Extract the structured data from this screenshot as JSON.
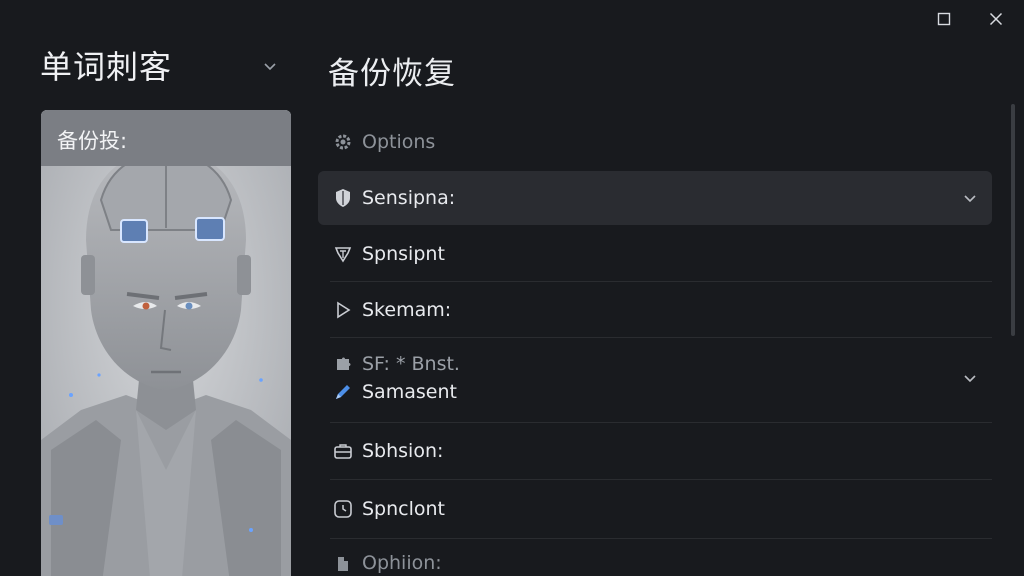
{
  "app": {
    "title": "单词刺客"
  },
  "card": {
    "header": "备份投:"
  },
  "main": {
    "title": "备份恢复",
    "items": [
      {
        "label": "Options",
        "icon": "gear-icon"
      },
      {
        "label": "Sensipna:",
        "icon": "shield-icon"
      },
      {
        "label": "Spnsipnt",
        "icon": "emblem-icon"
      },
      {
        "label": "Skemam:",
        "icon": "play-icon"
      },
      {
        "label": "SF: * Bnst.",
        "icon": "puzzle-icon"
      },
      {
        "label": "Samasent",
        "icon": "pen-icon"
      },
      {
        "label": "Sbhsion:",
        "icon": "briefcase-icon"
      },
      {
        "label": "Spnclont",
        "icon": "clock-icon"
      },
      {
        "label": "Ophiion:",
        "icon": "document-icon"
      }
    ]
  },
  "colors": {
    "background": "#181a1e",
    "selected_row": "#2a2c31",
    "accent_icon": "#4d8fe8"
  }
}
